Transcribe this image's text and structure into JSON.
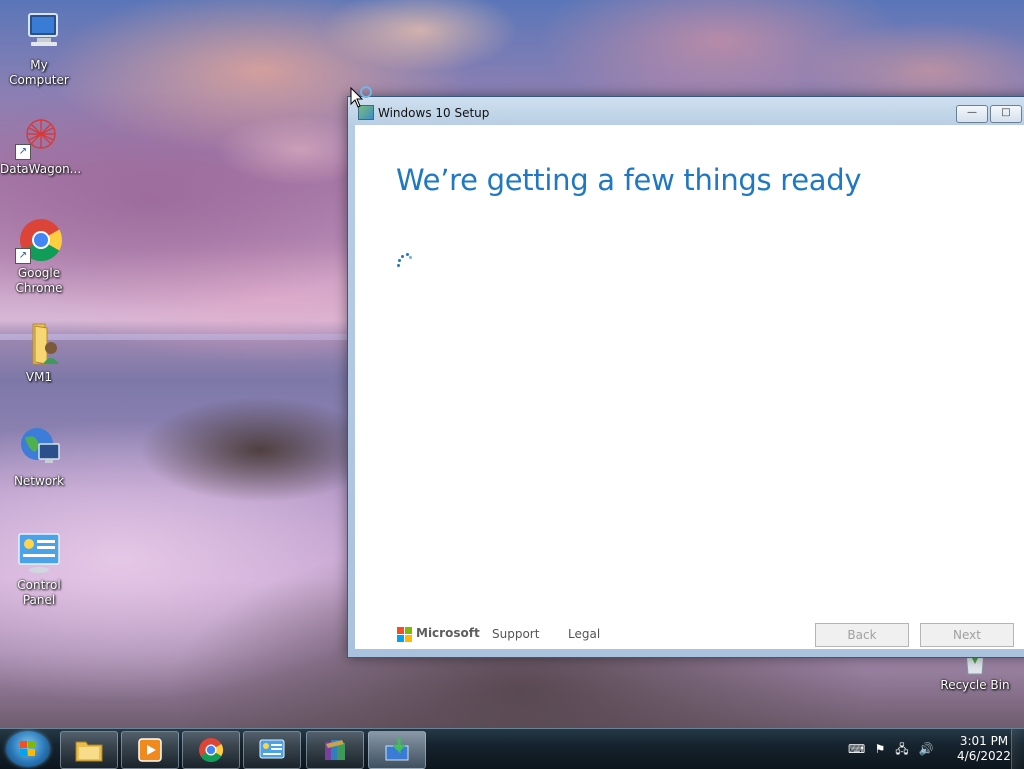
{
  "desktop": {
    "icons": [
      {
        "label": "My Computer",
        "icon": "computer-icon"
      },
      {
        "label": "DataWagon...",
        "icon": "datawagon-icon"
      },
      {
        "label_line1": "Google",
        "label_line2": "Chrome",
        "icon": "chrome-icon"
      },
      {
        "label": "VM1",
        "icon": "folder-user-icon"
      },
      {
        "label": "Network",
        "icon": "network-icon"
      },
      {
        "label": "Control Panel",
        "icon": "control-panel-icon"
      },
      {
        "label": "Recycle Bin",
        "icon": "recycle-bin-icon"
      }
    ]
  },
  "window": {
    "title": "Windows 10 Setup",
    "minimize_glyph": "—",
    "maximize_glyph": "□",
    "heading": "We’re getting a few things ready",
    "footer": {
      "brand": "Microsoft",
      "support_link": "Support",
      "legal_link": "Legal",
      "back_label": "Back",
      "next_label": "Next",
      "back_enabled": false,
      "next_enabled": false
    }
  },
  "taskbar": {
    "pinned": [
      {
        "name": "file-explorer",
        "icon": "folder-icon"
      },
      {
        "name": "media-player",
        "icon": "media-player-icon"
      },
      {
        "name": "google-chrome",
        "icon": "chrome-icon"
      },
      {
        "name": "control-panel",
        "icon": "control-panel-icon"
      },
      {
        "name": "winrar",
        "icon": "archive-icon"
      },
      {
        "name": "windows-10-setup",
        "icon": "setup-icon",
        "active": true
      }
    ],
    "tray": {
      "time": "3:01 PM",
      "date": "4/6/2022"
    }
  },
  "colors": {
    "heading_blue": "#1f78c4",
    "ms_red": "#f25022",
    "ms_green": "#7fba00",
    "ms_blue": "#00a4ef",
    "ms_yellow": "#ffb900"
  }
}
